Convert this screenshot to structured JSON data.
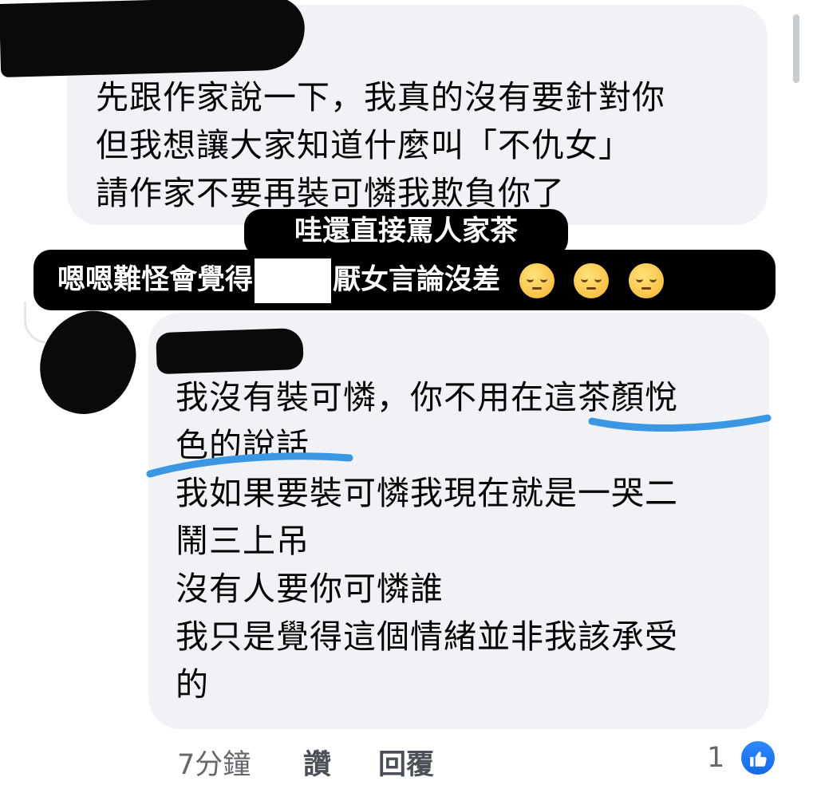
{
  "comment_1": {
    "lines": [
      "先跟作家說一下，我真的沒有要針對你",
      "但我想讓大家知道什麼叫「不仇女」",
      "請作家不要再裝可憐我欺負你了"
    ]
  },
  "overlay_captions": {
    "line_1": "哇還直接罵人家茶",
    "line_2_before": "嗯嗯難怪會覺得",
    "line_2_after": "厭女言論沒差",
    "emoji_count": 3,
    "emoji_icon": "pensive-face-icon"
  },
  "comment_2": {
    "lines": [
      "我沒有裝可憐，你不用在這茶顏悅",
      "色的說話",
      "我如果要裝可憐我現在就是一哭二",
      "鬧三上吊",
      "沒有人要你可憐誰",
      "我只是覺得這個情緒並非我該承受",
      "的"
    ],
    "highlight_color": "#3b97e3"
  },
  "comment_2_actions": {
    "time": "7分鐘",
    "like": "讚",
    "reply": "回覆",
    "reaction_count": "1",
    "reaction_icon": "like-thumb-icon",
    "reaction_color": "#1877f2"
  },
  "colors": {
    "bubble": "#f0f2f5",
    "caption_bg": "#000000",
    "caption_text": "#ffffff",
    "meta_text": "#65676b"
  }
}
